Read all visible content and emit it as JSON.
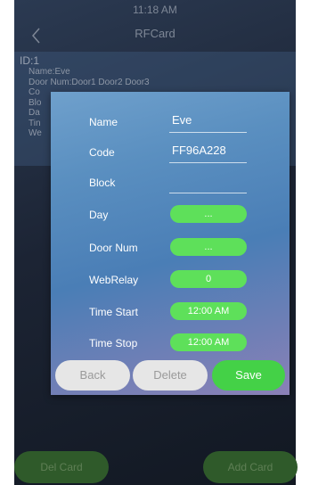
{
  "status": {
    "time": "11:18 AM"
  },
  "topbar": {
    "title": "RFCard"
  },
  "card_info": {
    "id_line": "ID:1",
    "name_line": "Name:Eve",
    "door_line": "Door Num:Door1 Door2 Door3",
    "code_line": "Co",
    "block_line": "Blo",
    "day_line": "Da",
    "time_line": "Tin",
    "webrelay_line": "We"
  },
  "bottom": {
    "del_card": "Del Card",
    "add_card": "Add Card"
  },
  "dialog": {
    "name": {
      "label": "Name",
      "value": "Eve"
    },
    "code": {
      "label": "Code",
      "value": "FF96A228"
    },
    "block": {
      "label": "Block",
      "value": ""
    },
    "day": {
      "label": "Day",
      "value": "..."
    },
    "door_num": {
      "label": "Door Num",
      "value": "..."
    },
    "webrelay": {
      "label": "WebRelay",
      "value": "0"
    },
    "time_start": {
      "label": "Time Start",
      "value": "12:00 AM"
    },
    "time_stop": {
      "label": "Time Stop",
      "value": "12:00 AM"
    },
    "buttons": {
      "back": "Back",
      "delete": "Delete",
      "save": "Save"
    }
  },
  "colors": {
    "accent_green": "#5ee05a",
    "save_green": "#44d147",
    "background": "#1c2434"
  }
}
